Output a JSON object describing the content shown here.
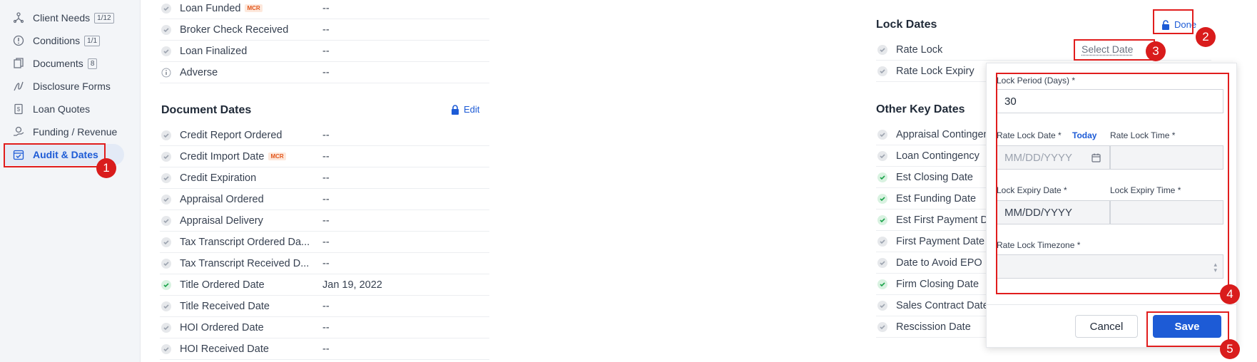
{
  "sidebar": {
    "items": [
      {
        "label": "Client Needs",
        "badge": "1/12",
        "icon": "client-needs-icon"
      },
      {
        "label": "Conditions",
        "badge": "1/1",
        "icon": "info-circle-icon"
      },
      {
        "label": "Documents",
        "badge": "8",
        "icon": "documents-icon"
      },
      {
        "label": "Disclosure Forms",
        "badge": "",
        "icon": "signature-icon"
      },
      {
        "label": "Loan Quotes",
        "badge": "",
        "icon": "dollar-document-icon"
      },
      {
        "label": "Funding / Revenue",
        "badge": "",
        "icon": "funding-icon"
      },
      {
        "label": "Audit & Dates",
        "badge": "",
        "icon": "calendar-check-icon",
        "active": true
      }
    ]
  },
  "top_rows": [
    {
      "label": "Loan Funded",
      "mcr": "MCR",
      "value": "--",
      "status": "pending"
    },
    {
      "label": "Broker Check Received",
      "value": "--",
      "status": "pending"
    },
    {
      "label": "Loan Finalized",
      "value": "--",
      "status": "pending"
    },
    {
      "label": "Adverse",
      "value": "--",
      "status": "info"
    }
  ],
  "document_dates": {
    "title": "Document Dates",
    "edit_label": "Edit",
    "rows": [
      {
        "label": "Credit Report Ordered",
        "value": "--",
        "status": "pending"
      },
      {
        "label": "Credit Import Date",
        "mcr": "MCR",
        "value": "--",
        "status": "pending"
      },
      {
        "label": "Credit Expiration",
        "value": "--",
        "status": "pending"
      },
      {
        "label": "Appraisal Ordered",
        "value": "--",
        "status": "pending"
      },
      {
        "label": "Appraisal Delivery",
        "value": "--",
        "status": "pending"
      },
      {
        "label": "Tax Transcript Ordered Da...",
        "value": "--",
        "status": "pending"
      },
      {
        "label": "Tax Transcript Received D...",
        "value": "--",
        "status": "pending"
      },
      {
        "label": "Title Ordered Date",
        "value": "Jan 19, 2022",
        "status": "done"
      },
      {
        "label": "Title Received Date",
        "value": "--",
        "status": "pending"
      },
      {
        "label": "HOI Ordered Date",
        "value": "--",
        "status": "pending"
      },
      {
        "label": "HOI Received Date",
        "value": "--",
        "status": "pending"
      }
    ]
  },
  "lock_dates": {
    "title": "Lock Dates",
    "done_label": "Done",
    "rows": [
      {
        "label": "Rate Lock",
        "status": "pending"
      },
      {
        "label": "Rate Lock Expiry",
        "status": "pending"
      }
    ],
    "select_date_label": "Select Date"
  },
  "other_key_dates": {
    "title": "Other Key Dates",
    "rows": [
      {
        "label": "Appraisal Contingen",
        "status": "pending"
      },
      {
        "label": "Loan Contingency",
        "status": "pending"
      },
      {
        "label": "Est Closing Date",
        "status": "done"
      },
      {
        "label": "Est Funding Date",
        "status": "done"
      },
      {
        "label": "Est First Payment D",
        "status": "done"
      },
      {
        "label": "First Payment Date",
        "status": "pending"
      },
      {
        "label": "Date to Avoid EPO",
        "status": "pending"
      },
      {
        "label": "Firm Closing Date",
        "status": "done"
      },
      {
        "label": "Sales Contract Date",
        "status": "pending"
      },
      {
        "label": "Rescission Date",
        "status": "pending"
      }
    ]
  },
  "popup": {
    "lock_period_label": "Lock Period (Days) *",
    "lock_period_value": "30",
    "rate_lock_date_label": "Rate Lock Date *",
    "today_label": "Today",
    "rate_lock_date_placeholder": "MM/DD/YYYY",
    "rate_lock_time_label": "Rate Lock Time *",
    "lock_expiry_date_label": "Lock Expiry Date *",
    "lock_expiry_date_value": "MM/DD/YYYY",
    "lock_expiry_time_label": "Lock Expiry Time *",
    "timezone_label": "Rate Lock Timezone *",
    "cancel_label": "Cancel",
    "save_label": "Save"
  },
  "callouts": [
    "1",
    "2",
    "3",
    "4",
    "5"
  ],
  "colors": {
    "accent": "#1d5bd6",
    "callout": "#d91c1c",
    "done_check": "#1aa34a"
  }
}
